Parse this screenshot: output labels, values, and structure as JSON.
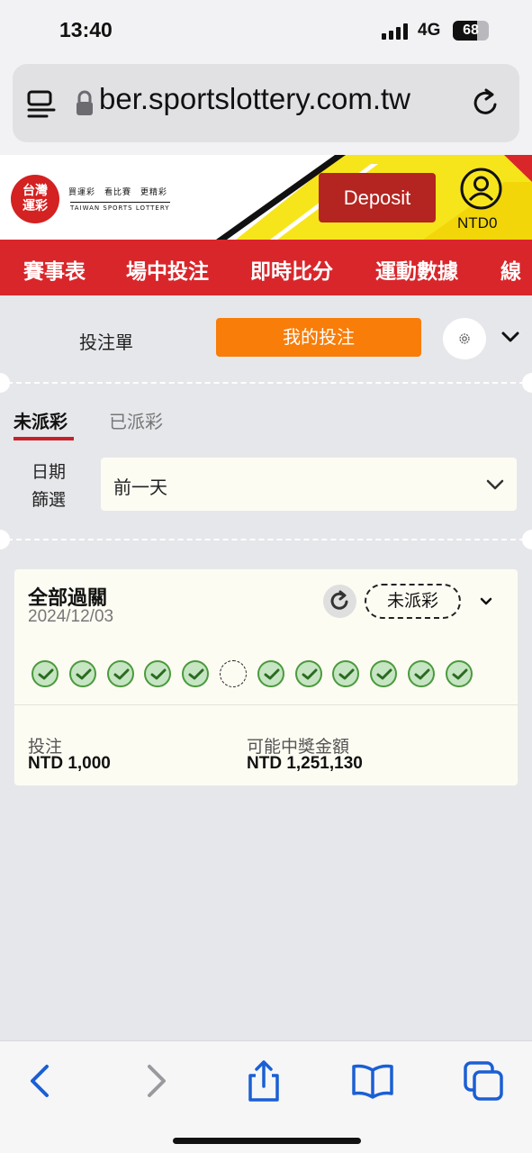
{
  "status_bar": {
    "time": "13:40",
    "network": "4G",
    "battery": "68",
    "battery_level": 0.68
  },
  "browser": {
    "url": "ber.sportslottery.com.tw"
  },
  "header": {
    "logo_text_line1": "台灣",
    "logo_text_line2": "運彩",
    "logo_tagline": "買運彩　看比賽　更精彩",
    "logo_english": "TAIWAN SPORTS LOTTERY",
    "deposit_label": "Deposit",
    "balance": "NTD0",
    "brand_red": "#d9262b",
    "brand_yellow": "#f7e51b"
  },
  "nav": {
    "items": [
      "賽事表",
      "場中投注",
      "即時比分",
      "運動數據",
      "線"
    ]
  },
  "panel": {
    "tab_betslip": "投注單",
    "tab_mybets": "我的投注",
    "subtab_open": "未派彩",
    "subtab_settled": "已派彩",
    "filter_label": "日期篩選",
    "filter_value": "前一天"
  },
  "bet": {
    "type": "全部過關",
    "date": "2024/12/03",
    "status": "未派彩",
    "legs": [
      "won",
      "won",
      "won",
      "won",
      "won",
      "pending",
      "won",
      "won",
      "won",
      "won",
      "won",
      "won"
    ],
    "stake_label": "投注",
    "stake_value": "NTD 1,000",
    "payout_label": "可能中獎金額",
    "payout_value": "NTD 1,251,130"
  },
  "accent_orange": "#f87d09"
}
